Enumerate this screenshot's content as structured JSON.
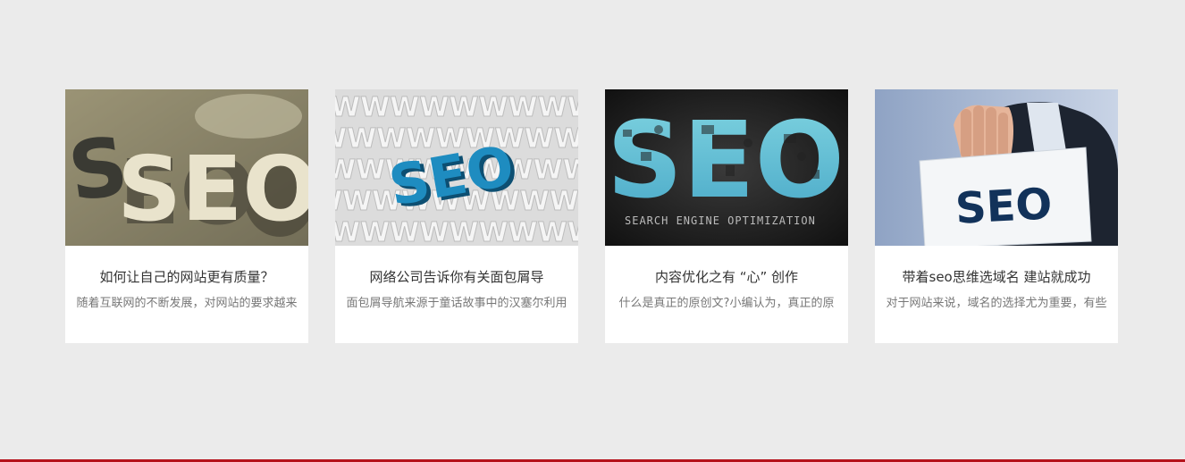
{
  "cards": [
    {
      "image_icon": "wooden-seo-letters-image",
      "image_text": "SEO",
      "title": "如何让自己的网站更有质量？",
      "excerpt": "随着互联网的不断发展，对网站的要求越来"
    },
    {
      "image_icon": "blue-seo-on-www-letters-image",
      "image_text": "SEO",
      "title": "网络公司告诉你有关面包屑导",
      "excerpt": "面包屑导航来源于童话故事中的汉塞尔利用"
    },
    {
      "image_icon": "seo-icons-collage-image",
      "image_text": "SEO",
      "image_caption": "SEARCH ENGINE OPTIMIZATION",
      "title": "内容优化之有 “心” 创作",
      "excerpt": "什么是真正的原创文?小编认为，真正的原"
    },
    {
      "image_icon": "hand-holding-seo-card-image",
      "image_text": "SEO",
      "title": "带着seo思维选域名 建站就成功",
      "excerpt": "对于网站来说，域名的选择尤为重要，有些"
    }
  ],
  "colors": {
    "page_background": "#ebebeb",
    "card_background": "#ffffff",
    "title_text": "#333333",
    "excerpt_text": "#777777",
    "bottom_bar": "#b5121b"
  }
}
